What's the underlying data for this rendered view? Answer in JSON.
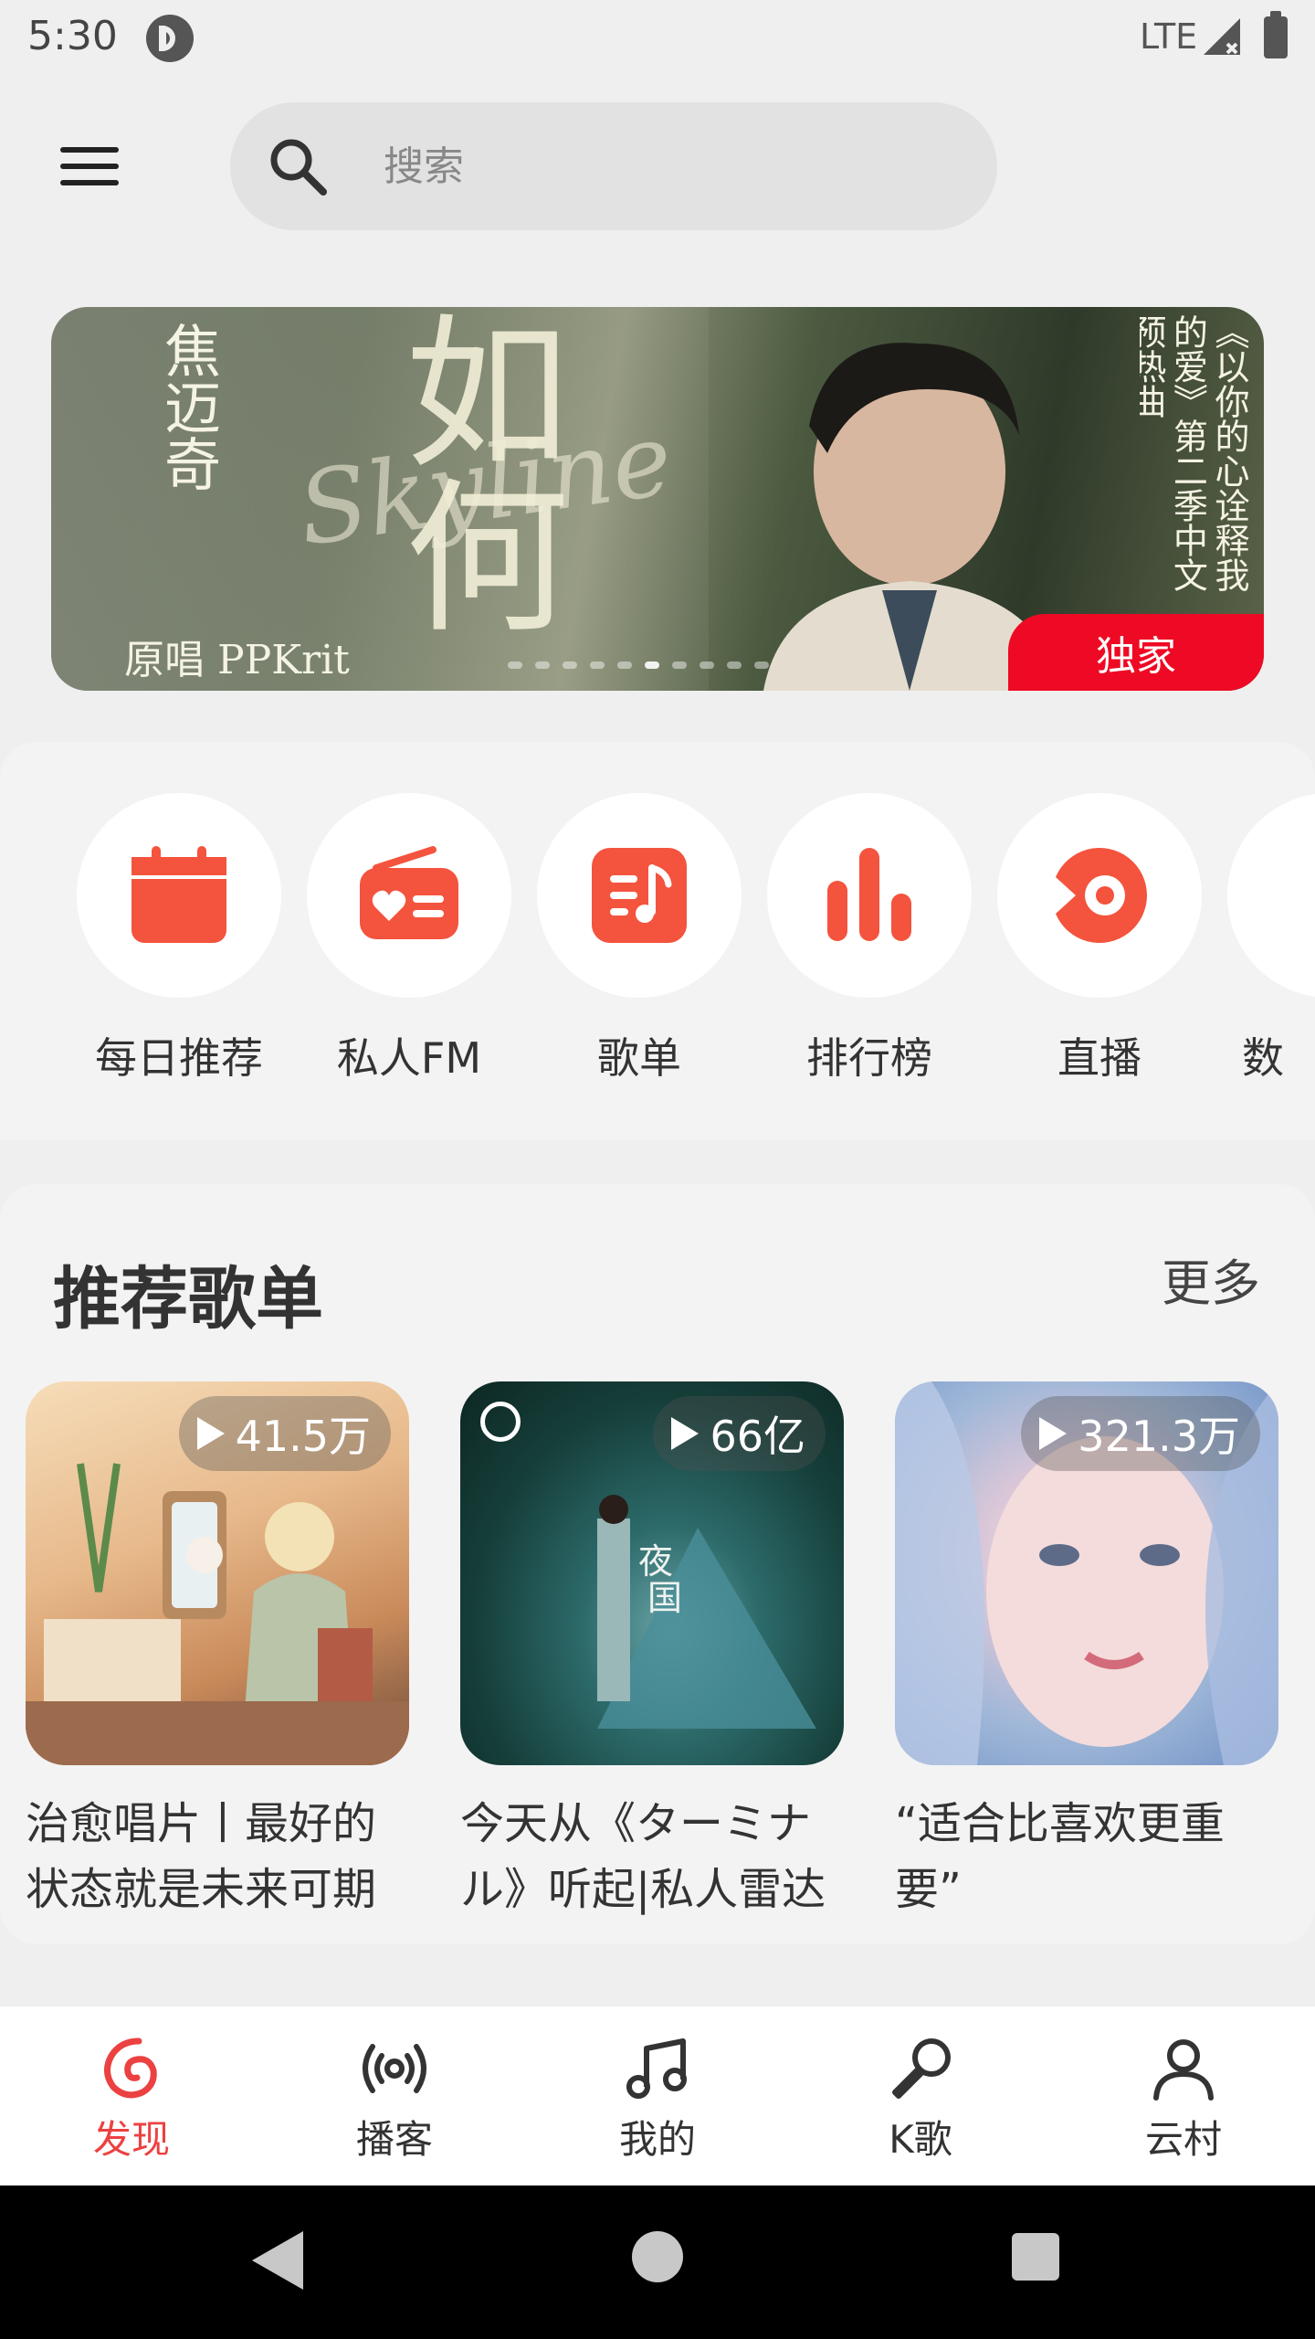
{
  "status_bar": {
    "time": "5:30",
    "network": "LTE"
  },
  "search": {
    "placeholder": "搜索"
  },
  "banner": {
    "artist": "焦迈奇",
    "song": "如何",
    "script": "Skyline",
    "credit": "原唱 PPKrit",
    "side_text": "《以你的心诠释我的爱》第二季中文预热曲",
    "badge": "独家"
  },
  "quick_nav": [
    {
      "label": "每日推荐",
      "icon": "calendar-icon"
    },
    {
      "label": "私人FM",
      "icon": "radio-icon"
    },
    {
      "label": "歌单",
      "icon": "playlist-icon"
    },
    {
      "label": "排行榜",
      "icon": "chart-icon"
    },
    {
      "label": "直播",
      "icon": "live-icon"
    },
    {
      "label": "数",
      "icon": "more-icon"
    }
  ],
  "recommended": {
    "title": "推荐歌单",
    "more": "更多",
    "playlists": [
      {
        "count": "41.5万",
        "title": "治愈唱片丨最好的状态就是未来可期"
      },
      {
        "count": "66亿",
        "title": "今天从《ターミナル》听起|私人雷达"
      },
      {
        "count": "321.3万",
        "title": "“适合比喜欢更重要”"
      }
    ]
  },
  "bottom_nav": [
    {
      "label": "发现",
      "icon": "discover-icon",
      "active": true
    },
    {
      "label": "播客",
      "icon": "podcast-icon",
      "active": false
    },
    {
      "label": "我的",
      "icon": "music-note-icon",
      "active": false
    },
    {
      "label": "K歌",
      "icon": "microphone-icon",
      "active": false
    },
    {
      "label": "云村",
      "icon": "community-icon",
      "active": false
    }
  ],
  "colors": {
    "accent": "#ec4141",
    "icon_red": "#f4533d",
    "badge_red": "#ee0a24"
  }
}
